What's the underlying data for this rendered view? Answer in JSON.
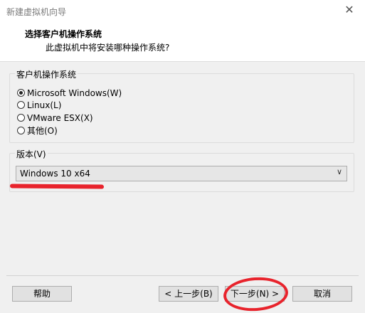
{
  "window": {
    "title": "新建虚拟机向导",
    "close_icon": "close-icon"
  },
  "header": {
    "title": "选择客户机操作系统",
    "subtitle": "此虚拟机中将安装哪种操作系统?"
  },
  "guest_os": {
    "legend": "客户机操作系统",
    "options": [
      {
        "label": "Microsoft Windows(W)",
        "checked": true
      },
      {
        "label": "Linux(L)",
        "checked": false
      },
      {
        "label": "VMware ESX(X)",
        "checked": false
      },
      {
        "label": "其他(O)",
        "checked": false
      }
    ]
  },
  "version": {
    "legend": "版本(V)",
    "selected": "Windows 10 x64",
    "arrow_icon": "chevron-down-icon"
  },
  "footer": {
    "help": "帮助",
    "back": "< 上一步(B)",
    "next": "下一步(N) >",
    "cancel": "取消"
  },
  "annotation_color": "#e8232c"
}
